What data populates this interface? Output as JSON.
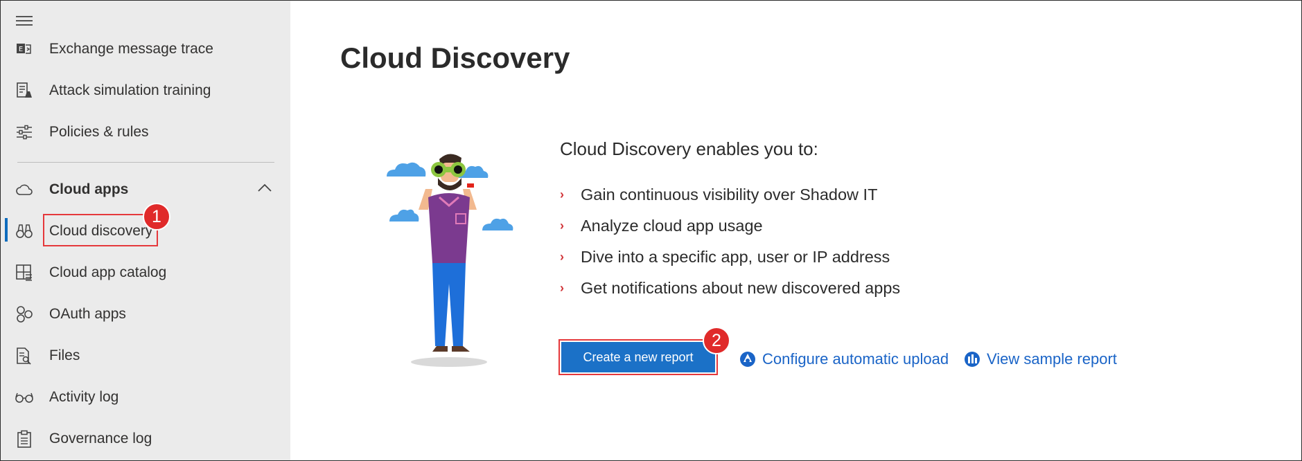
{
  "sidebar": {
    "items": [
      {
        "label": "Exchange message trace",
        "icon": "exchange-trace-icon"
      },
      {
        "label": "Attack simulation training",
        "icon": "attack-simulation-icon"
      },
      {
        "label": "Policies & rules",
        "icon": "sliders-icon"
      },
      {
        "label": "Cloud apps",
        "icon": "cloud-icon",
        "section": true,
        "expanded": true
      },
      {
        "label": "Cloud discovery",
        "icon": "binoculars-icon",
        "active": true
      },
      {
        "label": "Cloud app catalog",
        "icon": "catalog-icon"
      },
      {
        "label": "OAuth apps",
        "icon": "oauth-icon"
      },
      {
        "label": "Files",
        "icon": "file-search-icon"
      },
      {
        "label": "Activity log",
        "icon": "glasses-icon"
      },
      {
        "label": "Governance log",
        "icon": "clipboard-icon"
      }
    ]
  },
  "annotations": {
    "step1": "1",
    "step2": "2"
  },
  "main": {
    "title": "Cloud Discovery",
    "intro": "Cloud Discovery enables you to:",
    "bullets": [
      "Gain continuous visibility over Shadow IT",
      "Analyze cloud app usage",
      "Dive into a specific app, user or IP address",
      "Get notifications about new discovered apps"
    ],
    "create_report_label": "Create a new report",
    "configure_upload_label": "Configure automatic upload",
    "view_sample_label": "View sample report"
  },
  "colors": {
    "accent": "#1b71c7",
    "link": "#1a64c7",
    "annotation_red": "#e02a2a",
    "sidebar_bg": "#ebebeb"
  }
}
